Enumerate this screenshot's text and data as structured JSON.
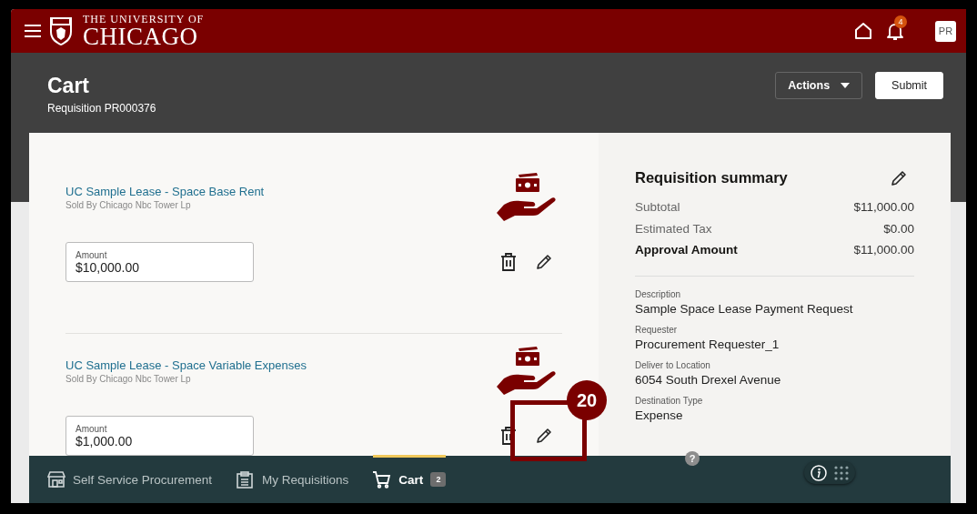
{
  "header": {
    "logo_line1": "THE UNIVERSITY OF",
    "logo_line2": "CHICAGO",
    "notifications_count": "4",
    "avatar": "PR"
  },
  "page": {
    "title": "Cart",
    "subtitle": "Requisition PR000376",
    "buttons": [
      {
        "label": "Actions",
        "kind": "menu"
      },
      {
        "label": "Submit",
        "kind": "primary"
      }
    ]
  },
  "cart_items": [
    {
      "title": "UC Sample Lease - Space Base Rent",
      "supplier": "Sold By Chicago Nbc Tower Lp",
      "amount_label": "Amount",
      "amount": "$10,000.00"
    },
    {
      "title": "UC Sample Lease - Space Variable Expenses",
      "supplier": "Sold By Chicago Nbc Tower Lp",
      "amount_label": "Amount",
      "amount": "$1,000.00"
    }
  ],
  "summary": {
    "title": "Requisition summary",
    "totals": [
      {
        "label": "Subtotal",
        "value": "$11,000.00",
        "emphasis": false
      },
      {
        "label": "Estimated Tax",
        "value": "$0.00",
        "emphasis": false
      },
      {
        "label": "Approval Amount",
        "value": "$11,000.00",
        "emphasis": true
      }
    ],
    "fields": [
      {
        "label": "Description",
        "value": "Sample Space Lease Payment Request"
      },
      {
        "label": "Requester",
        "value": "Procurement Requester_1"
      },
      {
        "label": "Deliver to Location",
        "value": "6054 South Drexel Avenue"
      },
      {
        "label": "Destination Type",
        "value": "Expense"
      }
    ],
    "help_marker": "?"
  },
  "bottom_nav": [
    {
      "label": "Self Service Procurement",
      "kind": "store",
      "selected": false
    },
    {
      "label": "My Requisitions",
      "kind": "clipboard",
      "selected": false
    },
    {
      "label": "Cart",
      "kind": "cart",
      "selected": true,
      "badge": "2"
    }
  ],
  "callout": {
    "number": "20"
  }
}
